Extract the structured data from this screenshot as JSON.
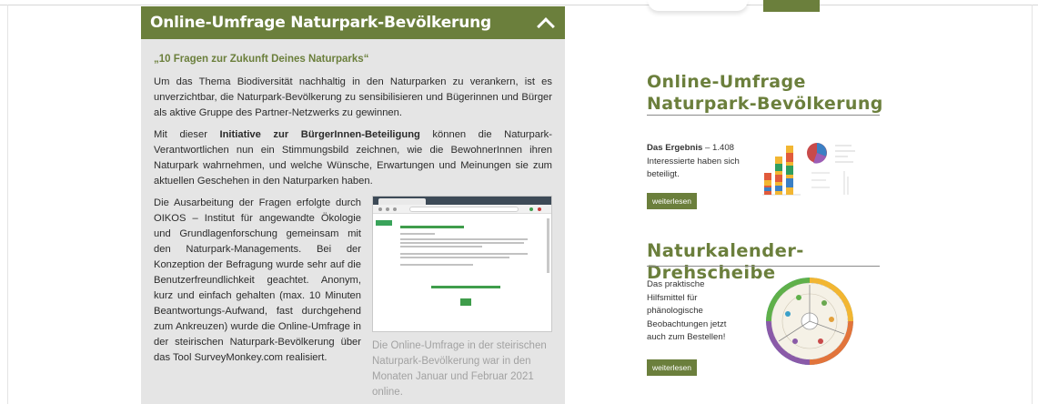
{
  "accordion": {
    "title": "Online-Umfrage Naturpark-Bevölkerung",
    "subheading": "„10 Fragen zur Zukunft Deines Naturparks“",
    "paragraph1": "Um das Thema Biodiversität nachhaltig in den Naturparken zu verankern, ist es unverzichtbar, die Naturpark-Bevölkerung zu sensibilisieren und Bügerinnen und Bürger als aktive Gruppe des Partner-Netzwerks zu gewinnen.",
    "paragraph2_pre": "Mit dieser ",
    "paragraph2_bold": "Initiative zur BürgerInnen-Beteiligung",
    "paragraph2_post": " können die Naturpark-Verantwortlichen nun ein Stimmungsbild zeichnen, wie die BewohnerInnen ihren Naturpark wahrnehmen, und welche Wünsche, Erwartungen und Meinungen sie zum aktuellen Geschehen in den Naturparken haben.",
    "paragraph3": "Die Ausarbeitung der Fragen erfolgte durch OIKOS – Institut für angewandte Ökologie und Grundlagenforschung gemeinsam mit den Naturpark-Managements. Bei der Konzeption der Befragung wurde sehr auf die Benutzerfreundlichkeit geachtet. Anonym, kurz und einfach gehalten (max. 10 Minuten Beantwortungs-Aufwand, fast durchgehend zum Ankreuzen) wurde die Online-Umfrage in der steirischen Naturpark-Bevölkerung über das Tool SurveyMonkey.com realisiert.",
    "image_caption": "Die Online-Umfrage in der steirischen Naturpark-Bevölkerung war in den Monaten Januar und Februar 2021 online."
  },
  "sidebar": {
    "survey": {
      "title": "Online-Umfrage Naturpark-Bevölkerung",
      "text_bold": "Das Ergebnis",
      "text_rest": " – 1.408 Interessierte haben sich beteiligt.",
      "button_label": "weiterlesen"
    },
    "calendar": {
      "title": "Naturkalender-Drehscheibe",
      "text": "Das praktische Hilfsmittel für phänologische Beobachtungen jetzt auch zum Bestellen!",
      "button_label": "weiterlesen"
    }
  },
  "icons": {
    "collapse": "chevron-up-icon"
  },
  "colors": {
    "brand_green": "#6b7f3c",
    "panel_bg": "#e5e5e5",
    "caption_gray": "#a2a2a2"
  }
}
